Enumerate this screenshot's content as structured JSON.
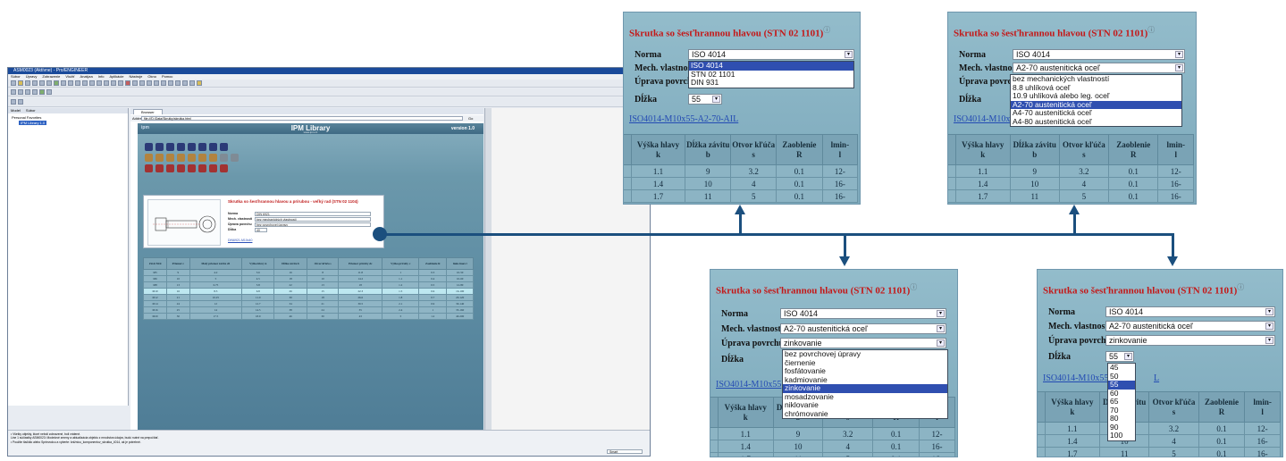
{
  "app": {
    "title": "ASM0023 (Aktívne) - Pro/ENGINEER",
    "menu": [
      "Súbor",
      "Úpravy",
      "Zobrazenie",
      "Vložiť",
      "Analýza",
      "Info",
      "Aplikácie",
      "Nástroje",
      "Okno",
      "Pomoc"
    ],
    "nav_tabs": [
      "Model",
      "Súbor"
    ],
    "tree": [
      "Personal Favorites",
      "IPM Library 1.0"
    ],
    "browser_tab": "Browser",
    "address_label": "Address",
    "address_value": "file:///D:/Data/Skrutky/skrutka.html",
    "go_label": "Go",
    "status_lines": [
      "• Všetky objekty, ktoré neboli zobrazené, boli vrátené.",
      "  Line 1 súčiastky ASM0023: Modelové zmeny a aktualizácia objektu z množstva údajov, budú nutné na prepočítať.",
      "• Použite tlačidlo alebo Sprievodcu a vyberte: knižnicu_komponentov_skrutka_4014, ak je potrebné."
    ],
    "zoom_value": "Smart"
  },
  "ipm": {
    "logo": "ipm",
    "title": "IPM Library",
    "subtitle": "www.ipm.cz",
    "version": "version 1.0",
    "small_title": "Skrutka so šesťhrannou hlavou a prírubou - veľký rad (STN 02 1104)",
    "small_form": [
      {
        "label": "Norma",
        "value": "DIN 6921"
      },
      {
        "label": "Mech. vlastnosti",
        "value": "bez mechanických vlastností"
      },
      {
        "label": "Úprava povrchu",
        "value": "bez povrchovej úpravy"
      },
      {
        "label": "Dĺžka",
        "value": "40"
      }
    ],
    "small_link": "DIN6921-M10x40",
    "small_table": {
      "headers": [
        "Závit M/d",
        "Priemer c",
        "Malý priemer závitu d1",
        "Výška hlavy k",
        "Dĺžka závitu b",
        "Otvor kľúča s",
        "Priemer príruby dc",
        "Výška príruby c",
        "Zaoblenie R",
        "lmin-lmax l"
      ],
      "rows": [
        [
          "M5",
          "9",
          "4.2",
          "3.6",
          "16",
          "8",
          "11.8",
          "1",
          "0.3",
          "10-50"
        ],
        [
          "M6",
          "10",
          "5",
          "4.5",
          "18",
          "10",
          "14.2",
          "1.1",
          "0.4",
          "10-60"
        ],
        [
          "M8",
          "13",
          "6.75",
          "5.8",
          "22",
          "13",
          "18",
          "1.2",
          "0.5",
          "12-80"
        ],
        [
          "M10",
          "16",
          "8.5",
          "6.8",
          "26",
          "15",
          "22.3",
          "1.5",
          "0.6",
          "16-100"
        ],
        [
          "M12",
          "21",
          "10.25",
          "11.0",
          "30",
          "18",
          "26.6",
          "1.8",
          "0.7",
          "20-120"
        ],
        [
          "M14",
          "24",
          "12",
          "12.7",
          "34",
          "21",
          "30.5",
          "2.1",
          "0.9",
          "30-140"
        ],
        [
          "M16",
          "25",
          "14",
          "14.5",
          "38",
          "24",
          "35",
          "2.4",
          "1",
          "35-160"
        ],
        [
          "M20",
          "30",
          "17.5",
          "18.9",
          "46",
          "30",
          "43",
          "3",
          "1.2",
          "40-200"
        ]
      ]
    }
  },
  "callouts": {
    "title": "Skrutka so šesťhrannou hlavou (STN 02 1101)",
    "info_mark": "ⓘ",
    "labels": {
      "norma": "Norma",
      "mech": "Mech. vlastnosti",
      "uprava": "Úprava povrchu",
      "dlzka": "Dĺžka"
    },
    "link_full": "ISO4014-M10x55-A2-70-AIL",
    "link_short": "ISO4014-M10x55",
    "link_tail": "L",
    "table_headers": [
      {
        "name": "Výška hlavy",
        "sym": "k"
      },
      {
        "name": "Dĺžka závitu",
        "sym": "b"
      },
      {
        "name": "Otvor kľúča",
        "sym": "s"
      },
      {
        "name": "Zaoblenie",
        "sym": "R"
      },
      {
        "name": "lmin-",
        "sym": "l"
      }
    ],
    "table_rows": [
      [
        "1.1",
        "9",
        "3.2",
        "0.1",
        "12-"
      ],
      [
        "1.4",
        "10",
        "4",
        "0.1",
        "16-"
      ],
      [
        "1.7",
        "11",
        "5",
        "0.1",
        "16-"
      ]
    ],
    "panel1": {
      "norma": "ISO 4014",
      "mech": "",
      "uprava": "",
      "dlzka": "55",
      "norma_options": [
        "ISO 4014",
        "STN 02 1101",
        "DIN 931"
      ]
    },
    "panel2": {
      "norma": "ISO 4014",
      "mech": "A2-70 austenitická oceľ",
      "mech_options": [
        "bez mechanických vlastností",
        "8.8 uhlíková oceľ",
        "10.9 uhlíková alebo leg. oceľ",
        "A2-70 austenitická oceľ",
        "A4-70 austenitická oceľ",
        "A4-80 austenitická oceľ"
      ]
    },
    "panel3": {
      "norma": "ISO 4014",
      "mech": "A2-70 austenitická oceľ",
      "uprava": "zinkovanie",
      "uprava_options": [
        "bez povrchovej úpravy",
        "čiernenie",
        "fosfátovanie",
        "kadmiovanie",
        "zinkovanie",
        "mosadzovanie",
        "niklovanie",
        "chrómovanie"
      ]
    },
    "panel4": {
      "norma": "ISO 4014",
      "mech": "A2-70 austenitická oceľ",
      "uprava": "zinkovanie",
      "dlzka": "55",
      "dlzka_options": [
        "45",
        "50",
        "55",
        "60",
        "65",
        "70",
        "80",
        "90",
        "100"
      ]
    }
  }
}
